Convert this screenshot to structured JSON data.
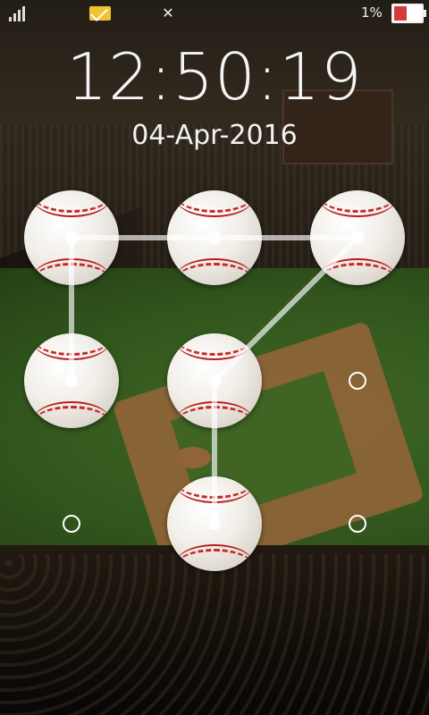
{
  "status_bar": {
    "icons": [
      "signal-icon",
      "mail-notification-icon",
      "missed-call-icon",
      "battery-low-icon"
    ],
    "battery_percent": "1%",
    "battery_level": 0.01,
    "battery_color": "#d43b3b"
  },
  "lockscreen": {
    "time": "12:50:19",
    "date": "04-Apr-2016"
  },
  "pattern": {
    "grid": 3,
    "drawn_sequence": [
      4,
      1,
      2,
      3,
      5,
      8
    ],
    "unselected_nodes": [
      6,
      9,
      7
    ],
    "line_color": "#ffffff"
  }
}
